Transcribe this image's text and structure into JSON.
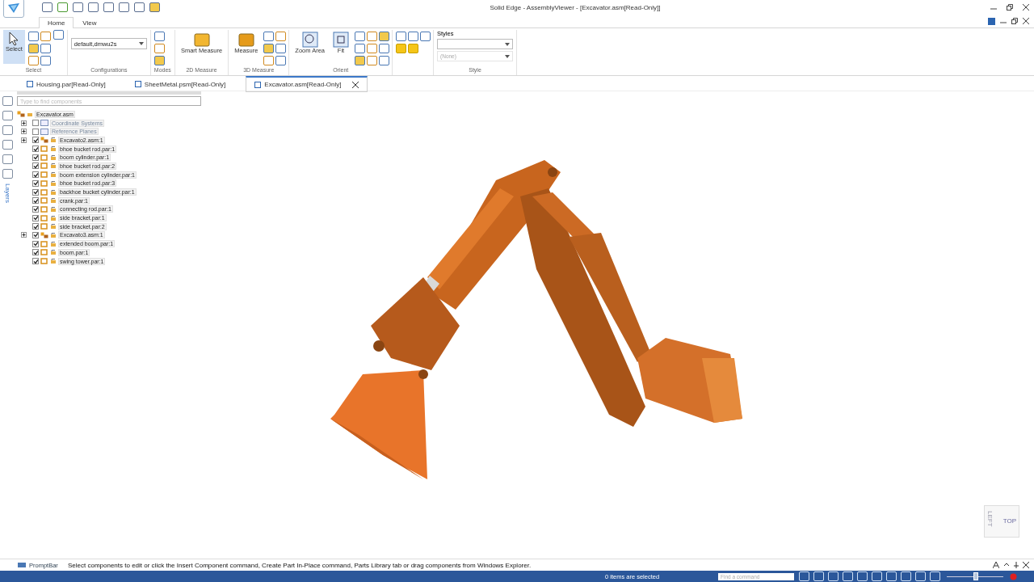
{
  "window": {
    "title": "Solid Edge - AssemblyViewer - [Excavator.asm[Read-Only]]"
  },
  "ribbon": {
    "tabs": [
      {
        "label": "Home",
        "selected": true
      },
      {
        "label": "View",
        "selected": false
      }
    ],
    "groups": [
      {
        "kind": "select",
        "label": "Select",
        "button": "Select",
        "selected": true
      },
      {
        "kind": "configurations",
        "label": "Configurations",
        "value": "default,dmwu2s"
      },
      {
        "kind": "modes",
        "label": "Modes"
      },
      {
        "kind": "measure2d",
        "label": "2D Measure",
        "button": "Smart Measure"
      },
      {
        "kind": "measure3d",
        "label": "3D Measure",
        "button": "Measure"
      },
      {
        "kind": "orient",
        "label": "Orient",
        "buttons": [
          "Zoom Area",
          "Fit"
        ]
      },
      {
        "kind": "views"
      },
      {
        "kind": "style",
        "label": "Style",
        "heading": "Styles",
        "disabled_value": "(None)"
      }
    ]
  },
  "document_tabs": [
    {
      "label": "Housing.par[Read-Only]",
      "selected": false
    },
    {
      "label": "SheetMetal.psm[Read-Only]",
      "selected": false
    },
    {
      "label": "Excavator.asm[Read-Only]",
      "selected": true
    }
  ],
  "side_rail": {
    "label": "Layers"
  },
  "pathfinder": {
    "search": {
      "placeholder": "Type to find components"
    },
    "root": {
      "label": "Excavator.asm",
      "children": [
        {
          "label": "Coordinate Systems",
          "kind": "folder",
          "checked": false,
          "expanded": false
        },
        {
          "label": "Reference Planes",
          "kind": "folder",
          "checked": false,
          "expanded": false
        },
        {
          "label": "Excavato2.asm:1",
          "kind": "assembly",
          "checked": true,
          "expanded": false
        },
        {
          "label": "bhoe bucket rod.par:1",
          "kind": "part",
          "checked": true
        },
        {
          "label": "boom cylinder.par:1",
          "kind": "part",
          "checked": true
        },
        {
          "label": "bhoe bucket rod.par:2",
          "kind": "part",
          "checked": true
        },
        {
          "label": "boom extension cylinder.par:1",
          "kind": "part",
          "checked": true
        },
        {
          "label": "bhoe bucket rod.par:3",
          "kind": "part",
          "checked": true
        },
        {
          "label": "backhoe bucket cylinder.par:1",
          "kind": "part",
          "checked": true
        },
        {
          "label": "crank.par:1",
          "kind": "part",
          "checked": true
        },
        {
          "label": "connecting rod.par:1",
          "kind": "part",
          "checked": true
        },
        {
          "label": "side bracket.par:1",
          "kind": "part",
          "checked": true
        },
        {
          "label": "side bracket.par:2",
          "kind": "part",
          "checked": true
        },
        {
          "label": "Excavato3.asm:1",
          "kind": "assembly",
          "checked": true,
          "expanded": false
        },
        {
          "label": "extended boom.par:1",
          "kind": "part",
          "checked": true
        },
        {
          "label": "boom.par:1",
          "kind": "part",
          "checked": true
        },
        {
          "label": "swing tower.par:1",
          "kind": "part",
          "checked": true
        }
      ]
    }
  },
  "viewport": {
    "kind": "picture",
    "view_cube": {
      "top": "TOP",
      "left": "LEFT"
    }
  },
  "prompt_bar": {
    "label": "PromptBar",
    "message": "Select components to edit or click the Insert Component command, Create Part In-Place command, Parts Library tab or drag components from Windows Explorer."
  },
  "status_bar": {
    "selection": "0 items are selected",
    "command_search": {
      "placeholder": "Find a command"
    },
    "zoom": {
      "level": 0.5
    }
  }
}
